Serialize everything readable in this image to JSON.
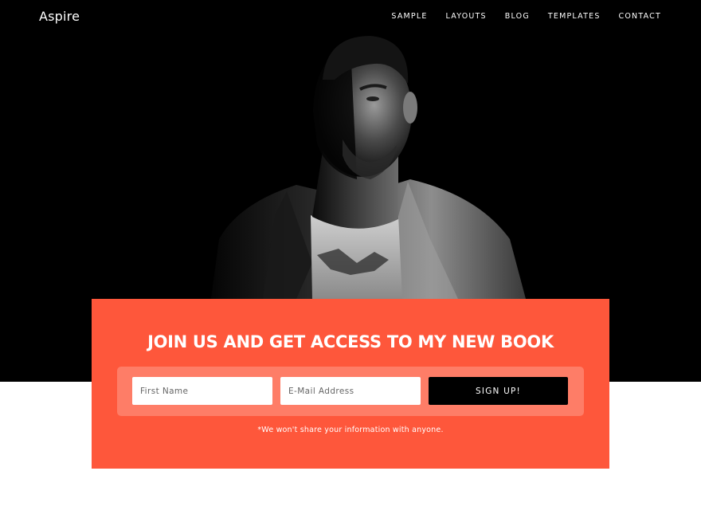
{
  "site": {
    "title": "Aspire"
  },
  "nav": {
    "items": [
      {
        "label": "SAMPLE"
      },
      {
        "label": "LAYOUTS"
      },
      {
        "label": "BLOG"
      },
      {
        "label": "TEMPLATES"
      },
      {
        "label": "CONTACT"
      }
    ]
  },
  "signup": {
    "heading": "JOIN US AND GET ACCESS TO MY NEW BOOK",
    "first_name_placeholder": "First Name",
    "email_placeholder": "E-Mail Address",
    "button_label": "SIGN UP!",
    "disclaimer": "*We won't share your information with anyone."
  },
  "colors": {
    "accent": "#fe573b",
    "panel": "#fe7d67",
    "hero_background": "#000000",
    "button": "#000000"
  }
}
